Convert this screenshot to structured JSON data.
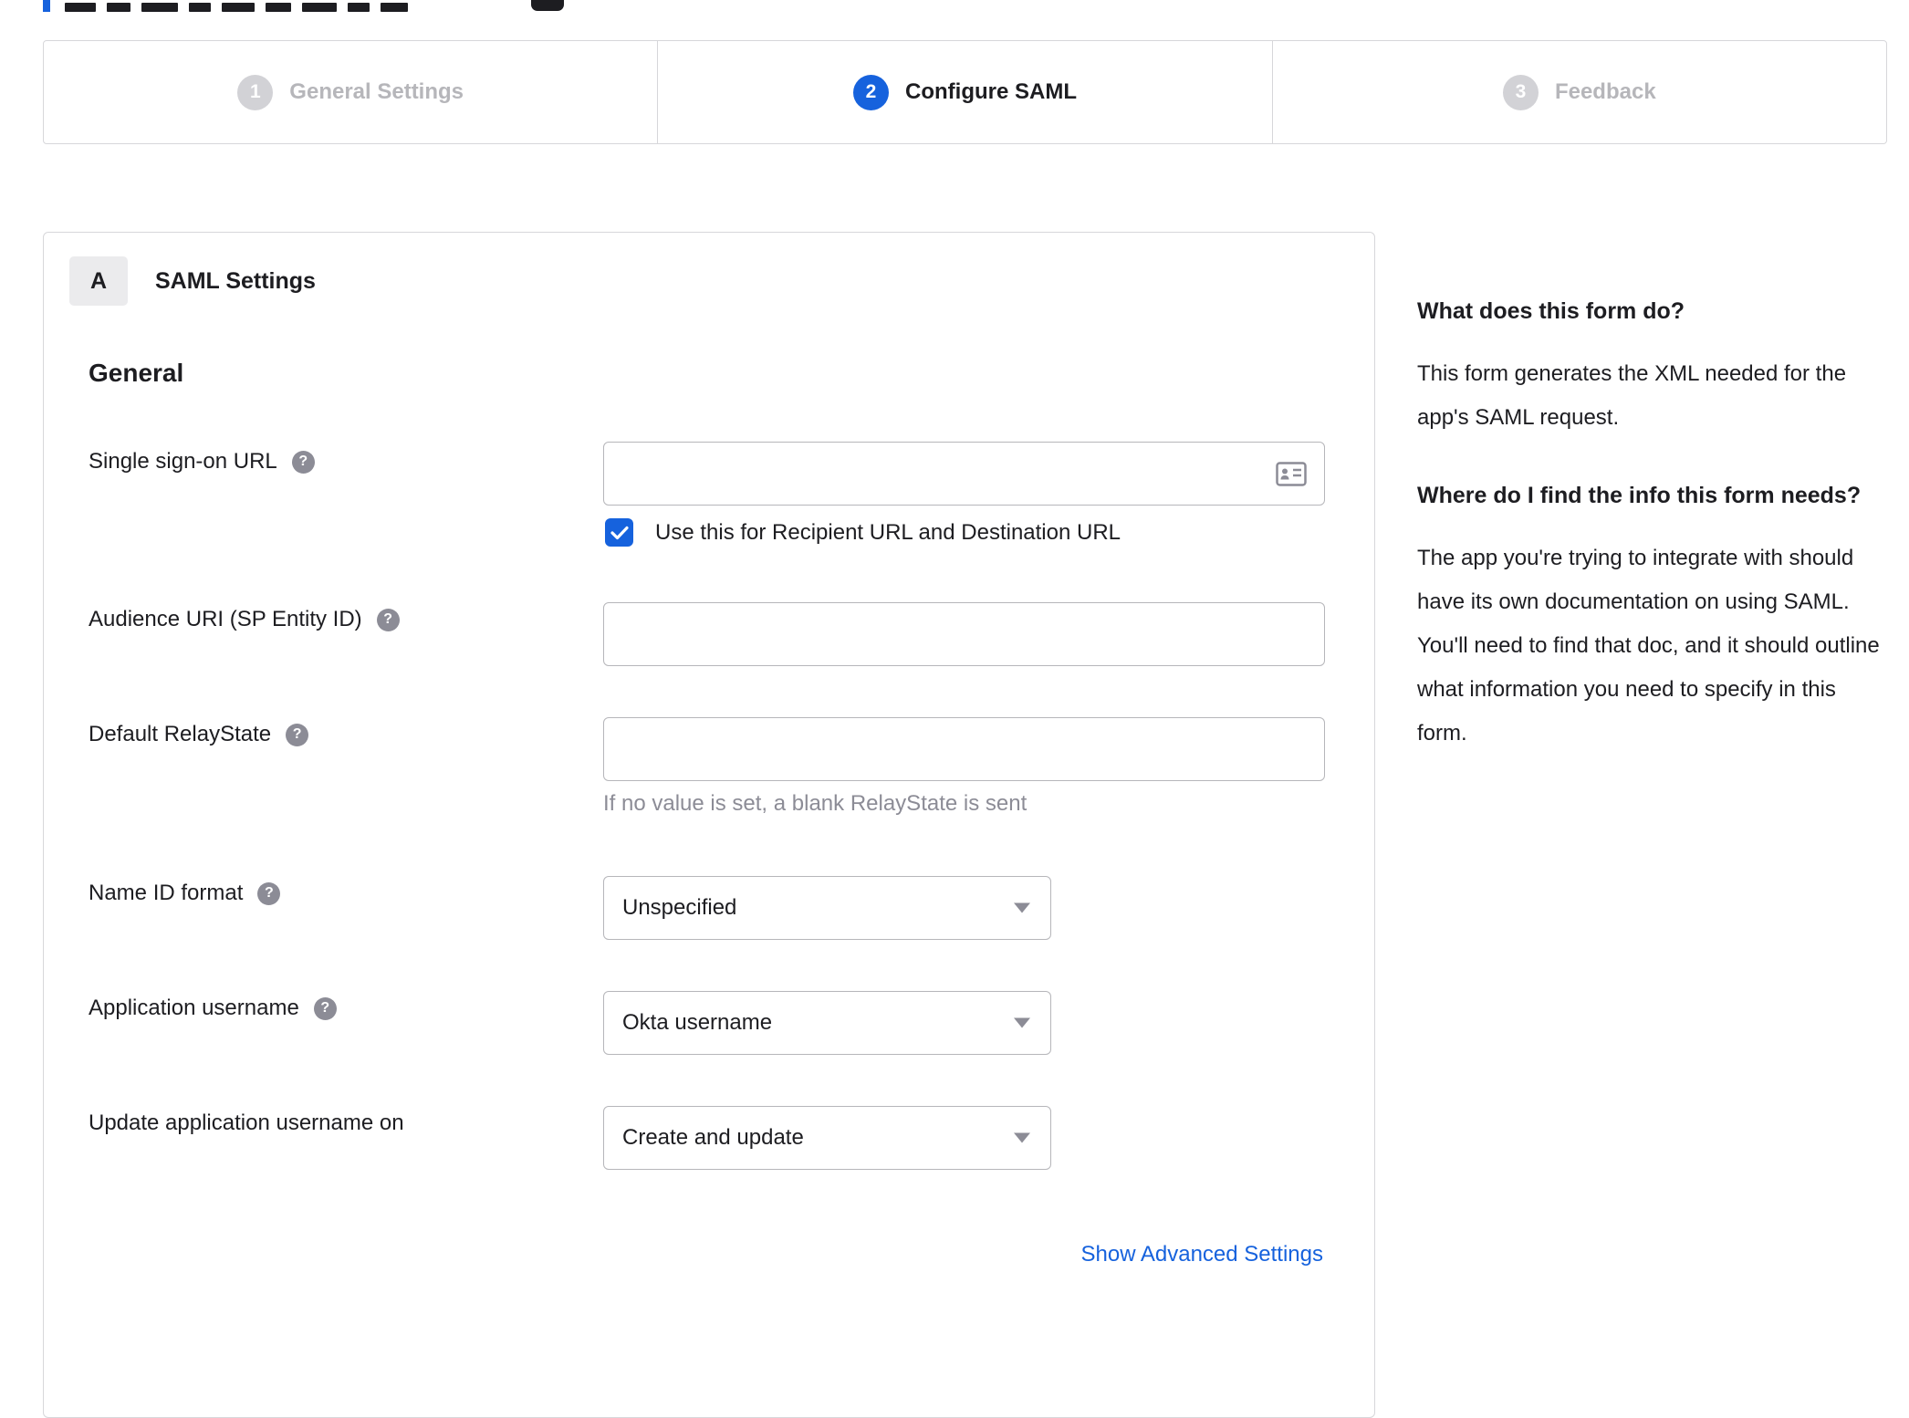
{
  "stepper": {
    "steps": [
      {
        "number": "1",
        "label": "General Settings"
      },
      {
        "number": "2",
        "label": "Configure SAML"
      },
      {
        "number": "3",
        "label": "Feedback"
      }
    ]
  },
  "panel": {
    "badge": "A",
    "title": "SAML Settings",
    "section": "General",
    "sso": {
      "label": "Single sign-on URL",
      "value": "",
      "checkbox_label": "Use this for Recipient URL and Destination URL",
      "checkbox_checked": true
    },
    "audience": {
      "label": "Audience URI (SP Entity ID)",
      "value": ""
    },
    "relay": {
      "label": "Default RelayState",
      "value": "",
      "hint": "If no value is set, a blank RelayState is sent"
    },
    "name_id": {
      "label": "Name ID format",
      "value": "Unspecified"
    },
    "app_username": {
      "label": "Application username",
      "value": "Okta username"
    },
    "update_username": {
      "label": "Update application username on",
      "value": "Create and update"
    },
    "advanced_link": "Show Advanced Settings"
  },
  "help_panel": {
    "sections": [
      {
        "heading": "What does this form do?",
        "body": "This form generates the XML needed for the app's SAML request."
      },
      {
        "heading": "Where do I find the info this form needs?",
        "body": "The app you're trying to integrate with should have its own documentation on using SAML. You'll need to find that doc, and it should outline what information you need to specify in this form."
      }
    ]
  },
  "colors": {
    "accent": "#1662dd",
    "inactive_gray": "#d2d2d6",
    "link": "#1662dd"
  }
}
